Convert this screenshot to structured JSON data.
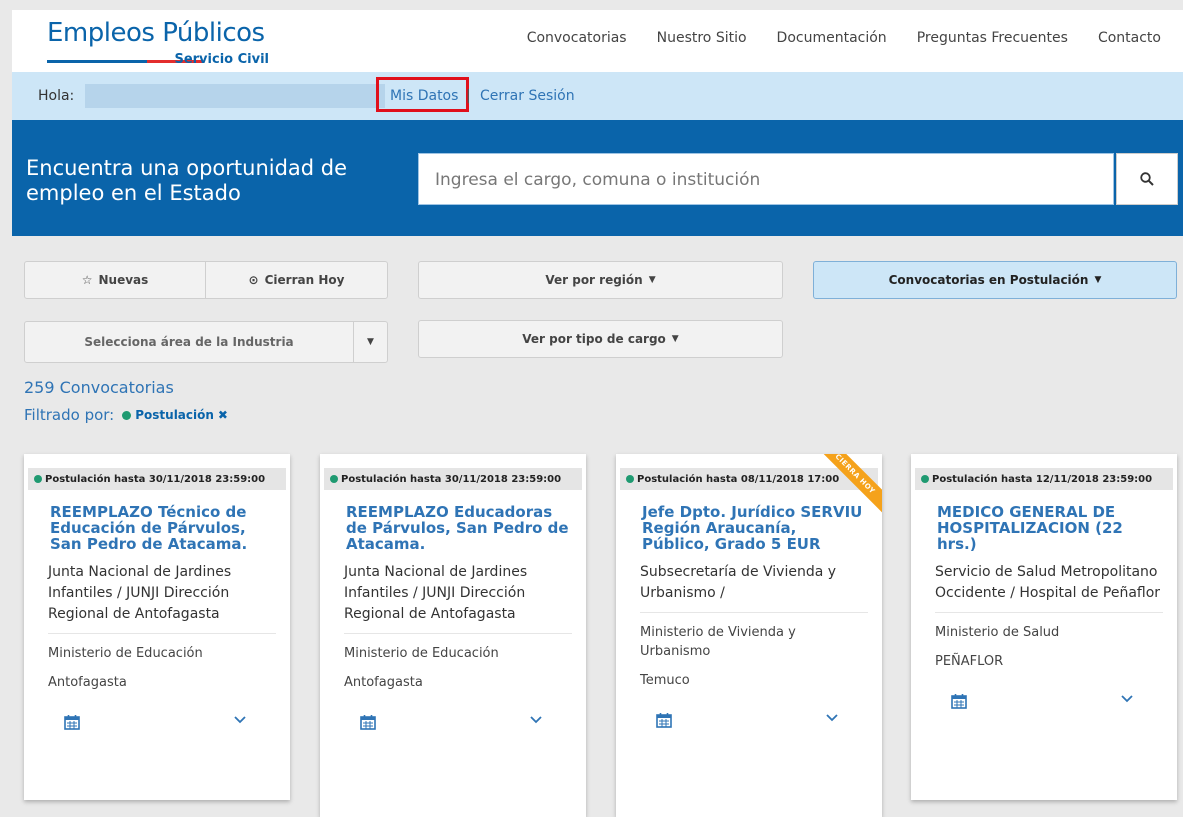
{
  "header": {
    "logo_title": "Empleos Públicos",
    "logo_subtitle": "Servicio Civil",
    "nav": [
      "Convocatorias",
      "Nuestro Sitio",
      "Documentación",
      "Preguntas Frecuentes",
      "Contacto"
    ]
  },
  "greeting": {
    "hola": "Hola:",
    "mis_datos": "Mis Datos",
    "separator": "|",
    "cerrar_sesion": "Cerrar Sesión"
  },
  "hero": {
    "title": "Encuentra una oportunidad de empleo en el Estado",
    "search_placeholder": "Ingresa el cargo, comuna o institución",
    "search_icon": "search-icon"
  },
  "filters": {
    "nuevas": "Nuevas",
    "cierran_hoy": "Cierran Hoy",
    "ver_region": "Ver por región",
    "convocatorias_postulacion": "Convocatorias en Postulación",
    "area_industria": "Selecciona área de la Industria",
    "tipo_cargo": "Ver por tipo de cargo"
  },
  "results": {
    "count": "259 Convocatorias",
    "filtrado_label": "Filtrado por:",
    "chip": "Postulación"
  },
  "colors": {
    "primary": "#0a64aa",
    "link": "#2f74b5",
    "status_green": "#1f9a71",
    "ribbon": "#f5a21b",
    "highlight": "#e0101b"
  },
  "cards": [
    {
      "deadline": "Postulación hasta 30/11/2018 23:59:00",
      "title": "REEMPLAZO Técnico de Educación de Párvulos, San Pedro de Atacama.",
      "institution": "Junta Nacional de Jardines Infantiles / JUNJI Dirección Regional de Antofagasta",
      "ministry": "Ministerio de Educación",
      "location": "Antofagasta",
      "ribbon": ""
    },
    {
      "deadline": "Postulación hasta 30/11/2018 23:59:00",
      "title": "REEMPLAZO Educadoras de Párvulos, San Pedro de Atacama.",
      "institution": "Junta Nacional de Jardines Infantiles / JUNJI Dirección Regional de Antofagasta",
      "ministry": "Ministerio de Educación",
      "location": "Antofagasta",
      "ribbon": ""
    },
    {
      "deadline": "Postulación hasta 08/11/2018 17:00",
      "title": "Jefe Dpto. Jurídico SERVIU Región Araucanía, Público, Grado 5 EUR",
      "institution": "Subsecretaría de Vivienda y Urbanismo /",
      "ministry": "Ministerio de Vivienda y Urbanismo",
      "location": "Temuco",
      "ribbon": "CIERRA HOY"
    },
    {
      "deadline": "Postulación hasta 12/11/2018 23:59:00",
      "title": "MEDICO GENERAL DE HOSPITALIZACION (22 hrs.)",
      "institution": "Servicio de Salud Metropolitano Occidente / Hospital de Peñaflor",
      "ministry": "Ministerio de Salud",
      "location": "PEÑAFLOR",
      "ribbon": ""
    }
  ]
}
